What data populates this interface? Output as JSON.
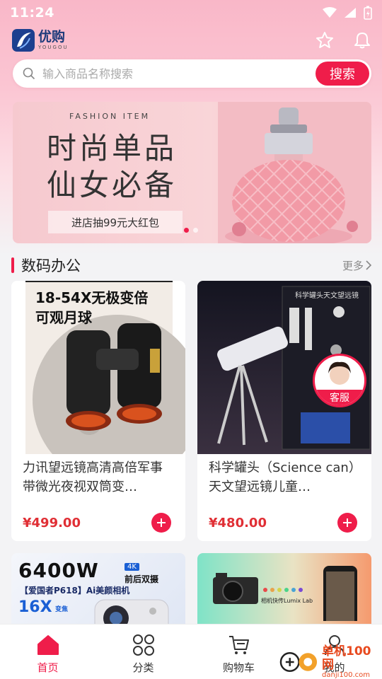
{
  "status_bar": {
    "time": "11:24"
  },
  "header": {
    "logo_cn": "优购",
    "logo_en": "YOUGOU"
  },
  "search": {
    "placeholder": "输入商品名称搜索",
    "button_label": "搜索"
  },
  "banner": {
    "kicker": "FASHION ITEM",
    "title_line1": "时尚单品",
    "title_line2": "仙女必备",
    "cta": "进店抽99元大红包"
  },
  "section": {
    "title": "数码办公",
    "more": "更多"
  },
  "products": [
    {
      "image_caption_line1": "18-54X无极变倍",
      "image_caption_line2": "可观月球",
      "name": "力讯望远镜高清高倍军事带微光夜视双筒变…",
      "price": "¥499.00"
    },
    {
      "image_caption": "科学罐头天文望远镜",
      "name": "科学罐头（Science can）天文望远镜儿童…",
      "price": "¥480.00"
    }
  ],
  "promos": [
    {
      "headline": "6400W",
      "badge": "4K",
      "badge_text": "前后双摄",
      "sub": "【爱国者P618】Ai美颜相机",
      "zoom": "16X",
      "zoom_suffix": "变焦"
    },
    {
      "caption": "相机快传Lumix Lab"
    }
  ],
  "service": {
    "label": "客服"
  },
  "tabs": [
    {
      "label": "首页",
      "icon": "home-icon",
      "active": true
    },
    {
      "label": "分类",
      "icon": "grid-icon",
      "active": false
    },
    {
      "label": "购物车",
      "icon": "cart-icon",
      "active": false
    },
    {
      "label": "我的",
      "icon": "user-icon",
      "active": false
    }
  ],
  "watermark": {
    "cn": "单机100网",
    "en": "danji100.com"
  },
  "colors": {
    "accent": "#ef1d4a",
    "price": "#e02f35",
    "header_pink": "#f9b7c8"
  }
}
